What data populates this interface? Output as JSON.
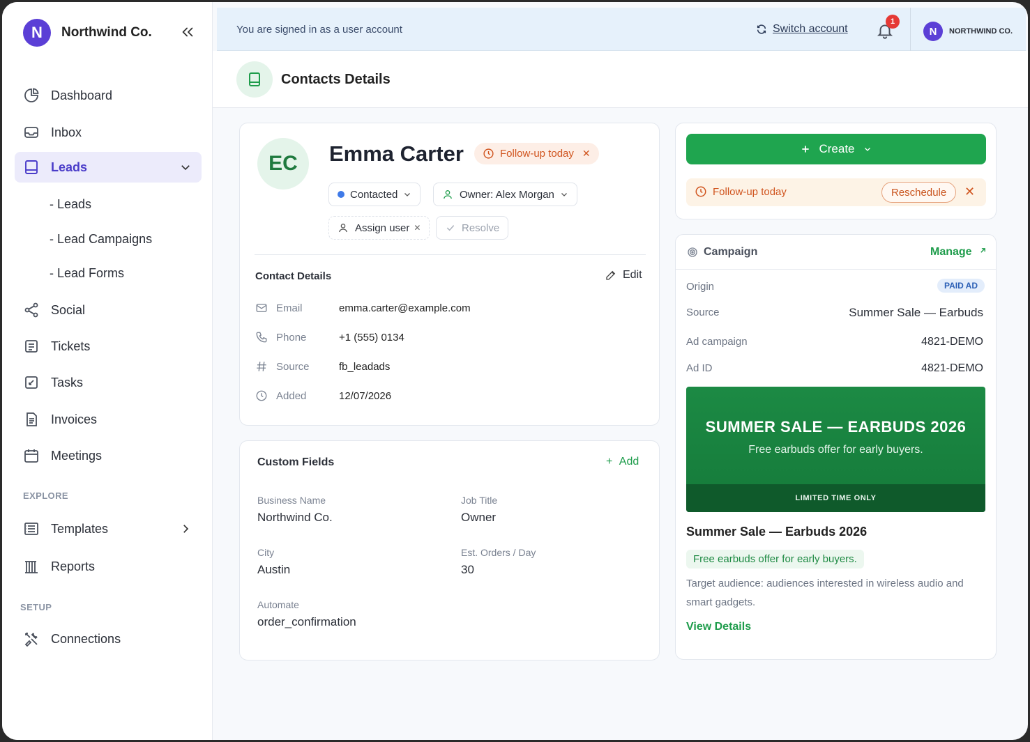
{
  "brand": {
    "logo_letter": "N",
    "name": "Northwind Co.",
    "color": "#5b3fd6"
  },
  "sidebar": {
    "items": [
      {
        "label": "Dashboard",
        "icon": "pie-chart-icon"
      },
      {
        "label": "Inbox",
        "icon": "inbox-icon"
      },
      {
        "label": "Leads",
        "icon": "tablet-icon",
        "active": true
      },
      {
        "label": "Social",
        "icon": "share-icon"
      },
      {
        "label": "Tickets",
        "icon": "ticket-icon"
      },
      {
        "label": "Tasks",
        "icon": "task-icon"
      },
      {
        "label": "Invoices",
        "icon": "invoice-icon"
      },
      {
        "label": "Meetings",
        "icon": "calendar-icon"
      }
    ],
    "sub_items": [
      "- Leads",
      "- Lead Campaigns",
      "- Lead Forms"
    ],
    "explore_label": "EXPLORE",
    "explore_items": [
      {
        "label": "Templates",
        "icon": "templates-icon"
      },
      {
        "label": "Reports",
        "icon": "reports-icon"
      }
    ],
    "setup_label": "SETUP",
    "setup_items": [
      {
        "label": "Connections",
        "icon": "tools-icon"
      }
    ]
  },
  "topbar": {
    "signed_in_text": "You are signed in as a user account",
    "switch_label": "Switch account",
    "notification_count": "1",
    "account_letter": "N",
    "account_name": "NORTHWIND CO."
  },
  "page": {
    "title": "Contacts Details",
    "accent": "#1fa54f"
  },
  "contact": {
    "initials": "EC",
    "name": "Emma Carter",
    "follow_up": "Follow-up today",
    "status": "Contacted",
    "owner": "Owner: Alex Morgan",
    "assign": "Assign user",
    "resolve": "Resolve",
    "details_title": "Contact Details",
    "edit_label": "Edit",
    "fields": [
      {
        "label": "Email",
        "value": "emma.carter@example.com"
      },
      {
        "label": "Phone",
        "value": "+1 (555) 0134"
      },
      {
        "label": "Source",
        "value": "fb_leadads"
      },
      {
        "label": "Added",
        "value": "12/07/2026"
      }
    ]
  },
  "custom_fields": {
    "title": "Custom Fields",
    "add_label": "Add",
    "items": [
      {
        "label": "Business Name",
        "value": "Northwind Co."
      },
      {
        "label": "Job Title",
        "value": "Owner"
      },
      {
        "label": "City",
        "value": "Austin"
      },
      {
        "label": "Est. Orders / Day",
        "value": "30"
      },
      {
        "label": "Automate",
        "value": "order_confirmation"
      }
    ]
  },
  "actions": {
    "create_label": "Create",
    "follow_up": "Follow-up today",
    "reschedule": "Reschedule"
  },
  "campaign": {
    "title": "Campaign",
    "manage": "Manage",
    "origin_label": "Origin",
    "origin_badge": "PAID AD",
    "source_label": "Source",
    "source_value": "Summer Sale — Earbuds",
    "ad_campaign_label": "Ad campaign",
    "ad_campaign_value": "4821-DEMO",
    "ad_id_label": "Ad ID",
    "ad_id_value": "4821-DEMO",
    "banner_title": "SUMMER SALE — EARBUDS 2026",
    "banner_sub": "Free earbuds offer for early buyers.",
    "banner_strip": "LIMITED TIME ONLY",
    "name": "Summer Sale — Earbuds 2026",
    "tagline": "Free earbuds offer for early buyers.",
    "description": "Target audience: audiences interested in wireless audio and smart gadgets.",
    "view_details": "View Details"
  }
}
